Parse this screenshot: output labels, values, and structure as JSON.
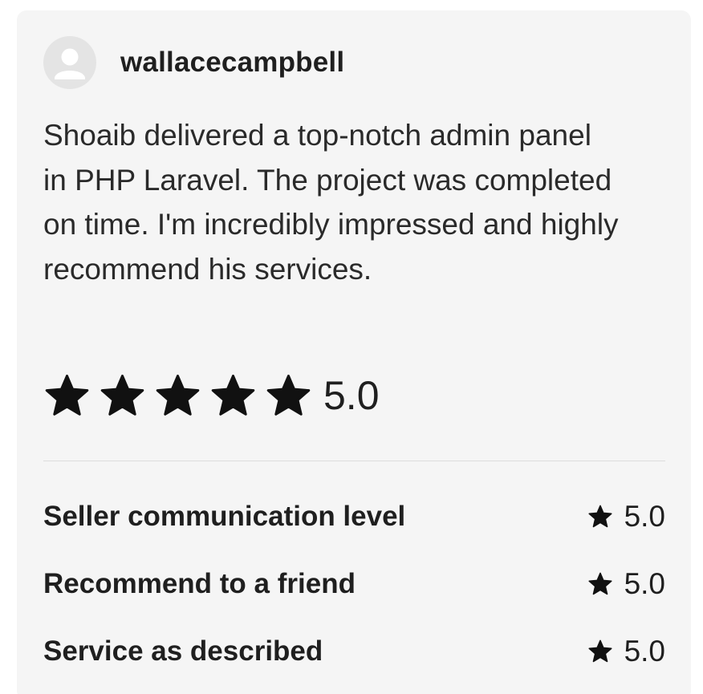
{
  "review": {
    "username": "wallacecampbell",
    "avatar_icon": "user-avatar-placeholder-icon",
    "text": "Shoaib delivered a top-notch admin panel in PHP Laravel. The project was completed on time. I'm incredibly impressed and highly recommend his services.",
    "rating": {
      "value": "5.0",
      "stars_filled": 5,
      "stars_total": 5,
      "star_icon": "star-icon",
      "star_color": "#111111"
    },
    "sub_ratings": [
      {
        "label": "Seller communication level",
        "value": "5.0"
      },
      {
        "label": "Recommend to a friend",
        "value": "5.0"
      },
      {
        "label": "Service as described",
        "value": "5.0"
      }
    ]
  },
  "colors": {
    "card_background": "#f5f5f5",
    "avatar_background": "#e4e4e4",
    "text": "#1f1f1f",
    "divider": "#dcdcdc"
  }
}
